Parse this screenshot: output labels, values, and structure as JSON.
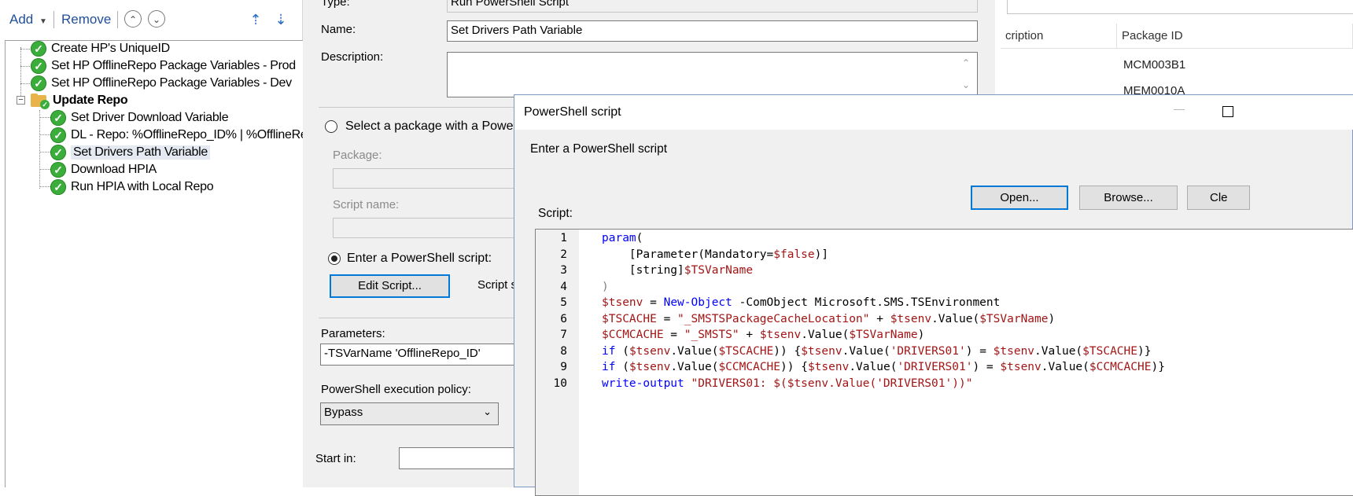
{
  "toolbar": {
    "add_label": "Add",
    "remove_label": "Remove",
    "move_up_icon": "double-chevron-up",
    "move_down_icon": "double-chevron-down"
  },
  "tree": {
    "items": [
      {
        "label": "Create HP's UniqueID"
      },
      {
        "label": "Set HP OfflineRepo Package Variables - Prod"
      },
      {
        "label": "Set HP OfflineRepo Package Variables - Dev"
      },
      {
        "label": "Update Repo",
        "group": true
      },
      {
        "label": "Set Driver Download Variable"
      },
      {
        "label": "DL - Repo: %OfflineRepo_ID% | %OfflineRe"
      },
      {
        "label": "Set Drivers Path Variable",
        "selected": true
      },
      {
        "label": "Download HPIA"
      },
      {
        "label": "Run HPIA  with Local Repo"
      }
    ]
  },
  "properties": {
    "type_label": "Type:",
    "type_value": "Run PowerShell Script",
    "name_label": "Name:",
    "name_value": "Set Drivers Path Variable",
    "description_label": "Description:",
    "description_value": "",
    "select_package_label": "Select a package with a PowerSh",
    "package_label": "Package:",
    "script_name_label": "Script name:",
    "enter_script_label": "Enter a PowerShell script:",
    "edit_script_button": "Edit Script...",
    "script_status_label": "Script s",
    "parameters_label": "Parameters:",
    "parameters_value": "-TSVarName 'OfflineRepo_ID'",
    "execution_policy_label": "PowerShell execution policy:",
    "execution_policy_value": "Bypass",
    "start_in_label": "Start in:"
  },
  "list": {
    "columns": [
      "cription",
      "Package ID"
    ],
    "rows": [
      {
        "package_id": "MCM003B1"
      },
      {
        "package_id": "MEM0010A"
      }
    ]
  },
  "dialog": {
    "title": "PowerShell script",
    "prompt": "Enter a PowerShell script",
    "open_button": "Open...",
    "browse_button": "Browse...",
    "clear_button": "Cle",
    "script_label": "Script:",
    "line_numbers": [
      "1",
      "2",
      "3",
      "4",
      "5",
      "6",
      "7",
      "8",
      "9",
      "10"
    ]
  }
}
